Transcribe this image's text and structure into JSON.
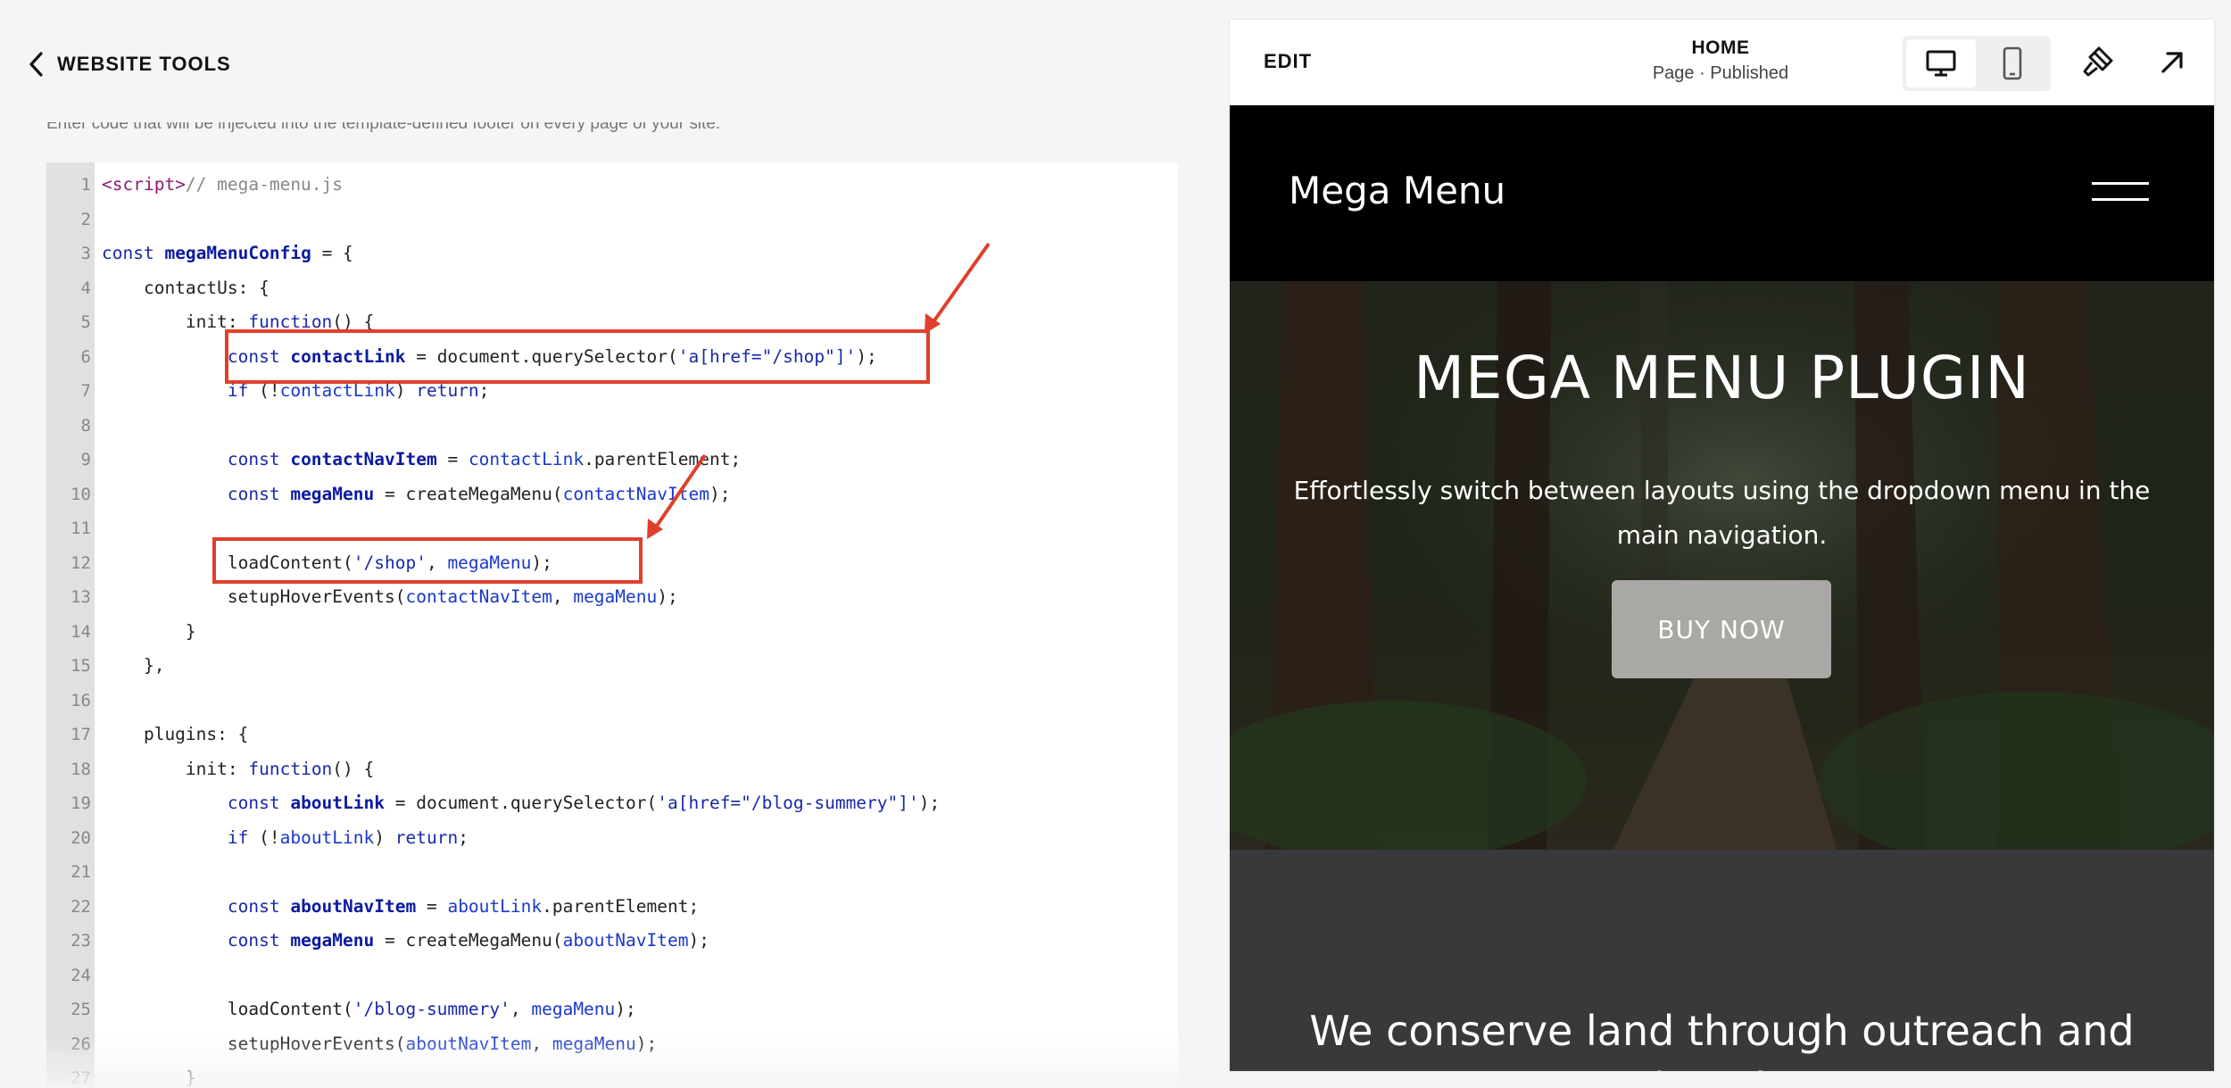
{
  "left_panel": {
    "back_label": "WEBSITE TOOLS",
    "description": "Enter code that will be injected into the template-defined footer on every page of your site."
  },
  "code_editor": {
    "lines": [
      {
        "n": "1",
        "tokens": [
          [
            "tag",
            "<script>"
          ],
          [
            "com",
            "// mega-menu.js"
          ]
        ]
      },
      {
        "n": "2",
        "tokens": []
      },
      {
        "n": "3",
        "tokens": [
          [
            "kw",
            "const "
          ],
          [
            "def",
            "megaMenuConfig"
          ],
          [
            "plain",
            " = {"
          ]
        ]
      },
      {
        "n": "4",
        "tokens": [
          [
            "plain",
            "    contactUs: {"
          ]
        ]
      },
      {
        "n": "5",
        "tokens": [
          [
            "plain",
            "        init: "
          ],
          [
            "kw",
            "function"
          ],
          [
            "plain",
            "() {"
          ]
        ]
      },
      {
        "n": "6",
        "tokens": [
          [
            "kw",
            "            const "
          ],
          [
            "def",
            "contactLink"
          ],
          [
            "plain",
            " = document.querySelector("
          ],
          [
            "str",
            "'a[href=\"/shop\"]'"
          ],
          [
            "plain",
            ");"
          ]
        ]
      },
      {
        "n": "7",
        "tokens": [
          [
            "kw",
            "            if "
          ],
          [
            "plain",
            "(!"
          ],
          [
            "var",
            "contactLink"
          ],
          [
            "plain",
            ") "
          ],
          [
            "kw",
            "return"
          ],
          [
            "plain",
            ";"
          ]
        ]
      },
      {
        "n": "8",
        "tokens": []
      },
      {
        "n": "9",
        "tokens": [
          [
            "kw",
            "            const "
          ],
          [
            "def",
            "contactNavItem"
          ],
          [
            "plain",
            " = "
          ],
          [
            "var",
            "contactLink"
          ],
          [
            "plain",
            ".parentElement;"
          ]
        ]
      },
      {
        "n": "10",
        "tokens": [
          [
            "kw",
            "            const "
          ],
          [
            "def",
            "megaMenu"
          ],
          [
            "plain",
            " = createMegaMenu("
          ],
          [
            "var",
            "contactNavItem"
          ],
          [
            "plain",
            ");"
          ]
        ]
      },
      {
        "n": "11",
        "tokens": []
      },
      {
        "n": "12",
        "tokens": [
          [
            "plain",
            "            loadContent("
          ],
          [
            "str",
            "'/shop'"
          ],
          [
            "plain",
            ", "
          ],
          [
            "var",
            "megaMenu"
          ],
          [
            "plain",
            ");"
          ]
        ]
      },
      {
        "n": "13",
        "tokens": [
          [
            "plain",
            "            setupHoverEvents("
          ],
          [
            "var",
            "contactNavItem"
          ],
          [
            "plain",
            ", "
          ],
          [
            "var",
            "megaMenu"
          ],
          [
            "plain",
            ");"
          ]
        ]
      },
      {
        "n": "14",
        "tokens": [
          [
            "plain",
            "        }"
          ]
        ]
      },
      {
        "n": "15",
        "tokens": [
          [
            "plain",
            "    },"
          ]
        ]
      },
      {
        "n": "16",
        "tokens": []
      },
      {
        "n": "17",
        "tokens": [
          [
            "plain",
            "    plugins: {"
          ]
        ]
      },
      {
        "n": "18",
        "tokens": [
          [
            "plain",
            "        init: "
          ],
          [
            "kw",
            "function"
          ],
          [
            "plain",
            "() {"
          ]
        ]
      },
      {
        "n": "19",
        "tokens": [
          [
            "kw",
            "            const "
          ],
          [
            "def",
            "aboutLink"
          ],
          [
            "plain",
            " = document.querySelector("
          ],
          [
            "str",
            "'a[href=\"/blog-summery\"]'"
          ],
          [
            "plain",
            ");"
          ]
        ]
      },
      {
        "n": "20",
        "tokens": [
          [
            "kw",
            "            if "
          ],
          [
            "plain",
            "(!"
          ],
          [
            "var",
            "aboutLink"
          ],
          [
            "plain",
            ") "
          ],
          [
            "kw",
            "return"
          ],
          [
            "plain",
            ";"
          ]
        ]
      },
      {
        "n": "21",
        "tokens": []
      },
      {
        "n": "22",
        "tokens": [
          [
            "kw",
            "            const "
          ],
          [
            "def",
            "aboutNavItem"
          ],
          [
            "plain",
            " = "
          ],
          [
            "var",
            "aboutLink"
          ],
          [
            "plain",
            ".parentElement;"
          ]
        ]
      },
      {
        "n": "23",
        "tokens": [
          [
            "kw",
            "            const "
          ],
          [
            "def",
            "megaMenu"
          ],
          [
            "plain",
            " = createMegaMenu("
          ],
          [
            "var",
            "aboutNavItem"
          ],
          [
            "plain",
            ");"
          ]
        ]
      },
      {
        "n": "24",
        "tokens": []
      },
      {
        "n": "25",
        "tokens": [
          [
            "plain",
            "            loadContent("
          ],
          [
            "str",
            "'/blog-summery'"
          ],
          [
            "plain",
            ", "
          ],
          [
            "var",
            "megaMenu"
          ],
          [
            "plain",
            ");"
          ]
        ]
      },
      {
        "n": "26",
        "tokens": [
          [
            "plain",
            "            setupHoverEvents("
          ],
          [
            "var",
            "aboutNavItem"
          ],
          [
            "plain",
            ", "
          ],
          [
            "var",
            "megaMenu"
          ],
          [
            "plain",
            ");"
          ]
        ]
      },
      {
        "n": "27",
        "tokens": [
          [
            "plain",
            "        }"
          ]
        ]
      }
    ]
  },
  "annotation_color": "#e0402a",
  "preview_toolbar": {
    "edit_label": "EDIT",
    "page_name": "HOME",
    "page_status": "Page · Published",
    "icons": [
      "desktop-icon",
      "mobile-icon",
      "paintbrush-icon",
      "arrow-up-right-icon"
    ]
  },
  "site": {
    "logo": "Mega Menu",
    "hero_title": "MEGA MENU PLUGIN",
    "hero_subtitle": "Effortlessly switch between layouts using the dropdown menu in the main navigation.",
    "cta_label": "BUY NOW",
    "section_heading": "We conserve land through outreach and",
    "section_heading_2": "education.",
    "colors": {
      "header_bg": "#000000",
      "section_bg": "#39393b",
      "cta_bg": "#aaa8a5"
    }
  }
}
